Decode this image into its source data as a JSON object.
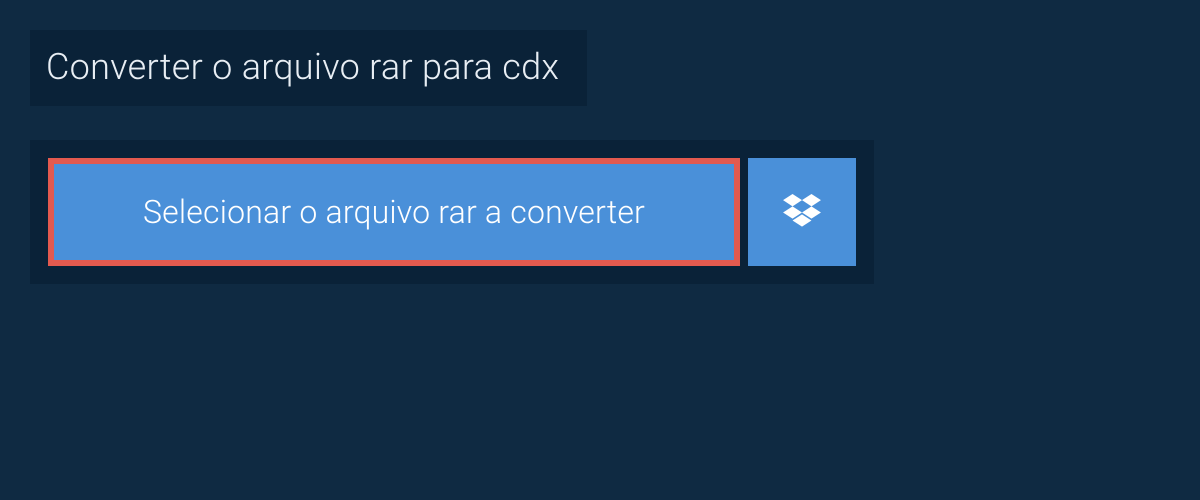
{
  "header": {
    "title": "Converter o arquivo rar para cdx"
  },
  "actions": {
    "select_file_label": "Selecionar o arquivo rar a converter"
  },
  "colors": {
    "background": "#0f2a42",
    "panel": "#0a2238",
    "button": "#4a90d9",
    "highlight_border": "#e35a4f",
    "text_light": "#e8eef4",
    "text_white": "#ffffff"
  }
}
